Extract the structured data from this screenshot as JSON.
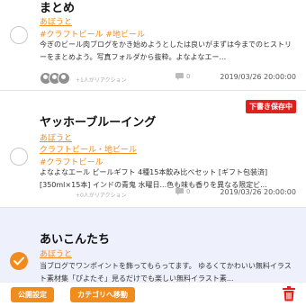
{
  "entries": [
    {
      "title": "まとめ",
      "author": "あぼうと",
      "categories": "#クラフトビール #地ビール",
      "excerpt": "今ぎのビール肉ブログをかき始めようとしたは良いがまずは今までのヒストリーをまとめよう。写真フォルダから抜粋。よなよなエー...",
      "reaction": "+1人がリアクション",
      "comments": "0",
      "date": "2019/03/26 20:00:00",
      "selected": false
    },
    {
      "title": "ヤッホーブルーイング",
      "author": "あぼうと",
      "categories": "クラフトビール・地ビール",
      "categories2": "#クラフトビール",
      "excerpt": "よなよなエール ビールギフト 4種15本飲み比べセット [ギフト包装済] [350ml×15本] インドの青鬼 水曜日...色も味も香りを異なる限定ビ...",
      "reaction": "+0人がリアクション",
      "comments": "0",
      "date": "2019/03/26 20:00:00",
      "badge": "下書き保存中",
      "selected": false
    },
    {
      "title": "あいこんたち",
      "author": "あぼうと",
      "excerpt": "当ブログでワンポイントを飾ってもらってます。 ゆるくてかわいい無料イラスト素材集「ぴよたそ」見るだけでも楽しい無料イラスト素...",
      "selected": true
    }
  ],
  "toolbar": {
    "publish_label": "公開設定",
    "category_label": "カテゴリへ移動"
  },
  "colors": {
    "accent": "#f08c1e",
    "badge": "#e0201f",
    "selected_bg": "#eef1fb"
  },
  "icons": [
    "comment-icon",
    "check-icon",
    "trash-icon",
    "avatar"
  ]
}
